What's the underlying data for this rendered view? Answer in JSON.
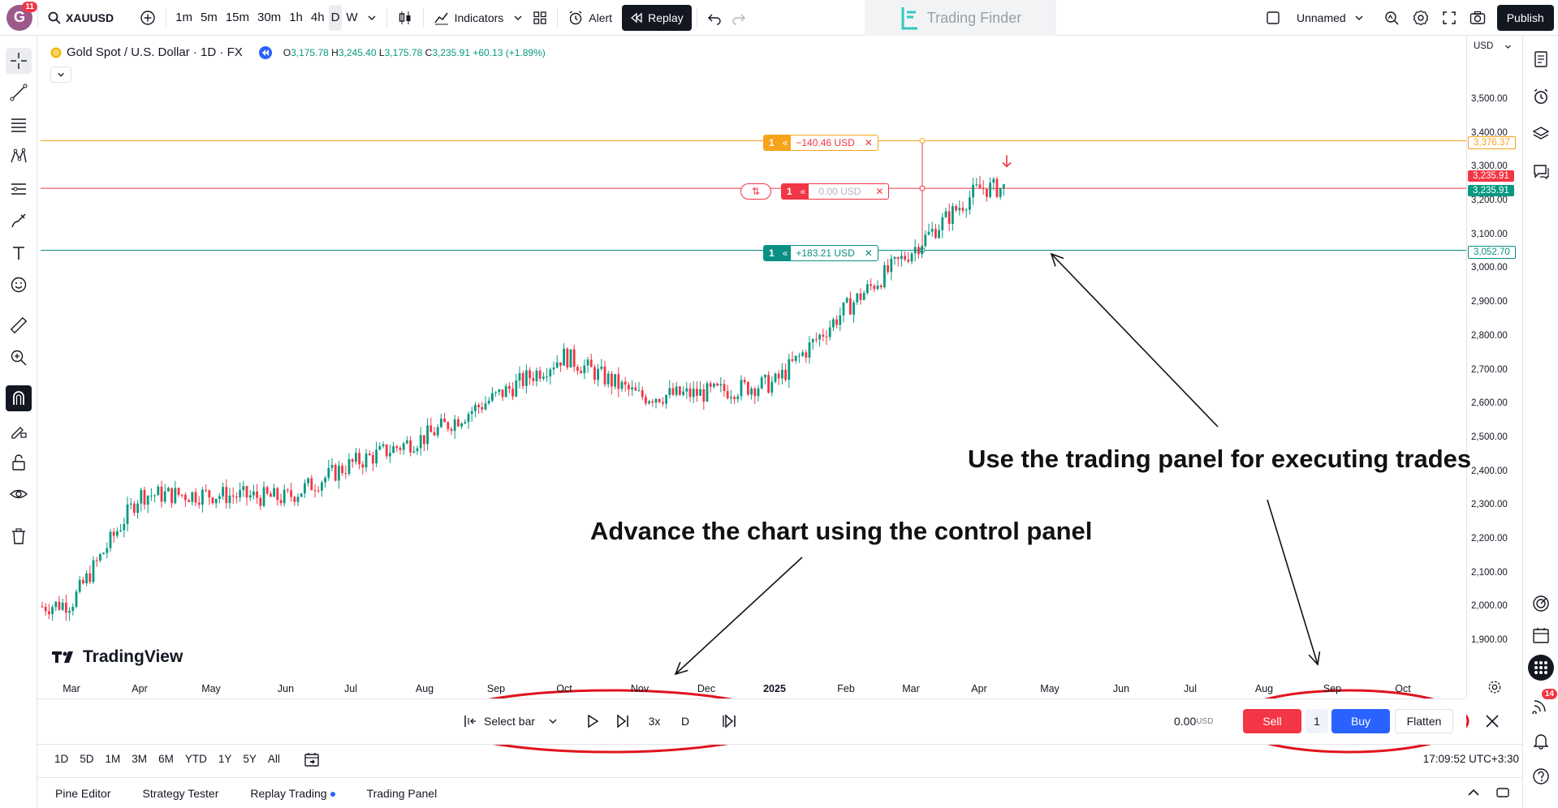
{
  "topbar": {
    "avatar_letter": "G",
    "notification_count": "11",
    "symbol": "XAUUSD",
    "intervals": [
      "1m",
      "5m",
      "15m",
      "30m",
      "1h",
      "4h",
      "D",
      "W"
    ],
    "indicators_label": "Indicators",
    "alert_label": "Alert",
    "replay_label": "Replay",
    "watermark": "Trading Finder",
    "layout_name": "Unnamed",
    "publish_label": "Publish"
  },
  "legend": {
    "title": "Gold Spot / U.S. Dollar · 1D · FX",
    "o_label": "O",
    "o": "3,175.78",
    "h_label": "H",
    "h": "3,245.40",
    "l_label": "L",
    "l": "3,175.78",
    "c_label": "C",
    "c": "3,235.91",
    "change": "+60.13 (+1.89%)"
  },
  "price_scale": {
    "currency": "USD",
    "labels": [
      "3,500.00",
      "3,400.00",
      "3,300.00",
      "3,200.00",
      "3,100.00",
      "3,000.00",
      "2,900.00",
      "2,800.00",
      "2,700.00",
      "2,600.00",
      "2,500.00",
      "2,400.00",
      "2,300.00",
      "2,200.00",
      "2,100.00",
      "2,000.00",
      "1,900.00"
    ],
    "tp_tag": "3,376.37",
    "last_tag": "3,235.91",
    "entry_tag": "3,235.91",
    "sl_tag": "3,052.70"
  },
  "orders": {
    "tp": {
      "qty": "1",
      "pnl": "−140.46 USD"
    },
    "entry": {
      "qty": "1",
      "pnl": "0.00 USD"
    },
    "sl": {
      "qty": "1",
      "pnl": "+183.21 USD"
    }
  },
  "time_axis": [
    "Mar",
    "Apr",
    "May",
    "Jun",
    "Jul",
    "Aug",
    "Sep",
    "Oct",
    "Nov",
    "Dec",
    "2025",
    "Feb",
    "Mar",
    "Apr",
    "May",
    "Jun",
    "Jul",
    "Aug",
    "Sep",
    "Oct"
  ],
  "brand": "TradingView",
  "annotations": {
    "trading_panel": "Use the trading panel for executing trades",
    "control_panel": "Advance the chart using the control panel"
  },
  "replay": {
    "select_bar": "Select bar",
    "speed": "3x",
    "interval": "D",
    "pnl": "0.00",
    "pnl_currency": "USD",
    "sell": "Sell",
    "qty": "1",
    "buy": "Buy",
    "flatten": "Flatten"
  },
  "ranges": [
    "1D",
    "5D",
    "1M",
    "3M",
    "6M",
    "YTD",
    "1Y",
    "5Y",
    "All"
  ],
  "clock": "17:09:52 UTC+3:30",
  "bottom_tabs": [
    "Pine Editor",
    "Strategy Tester",
    "Replay Trading",
    "Trading Panel"
  ],
  "right_badge": "14",
  "colors": {
    "up": "#089981",
    "down": "#f23645",
    "accent": "#2962ff",
    "tp": "#f7a21b",
    "sl": "#0a8f83"
  },
  "chart_data": {
    "type": "candlestick",
    "x_start": "2024-03",
    "x_end": "2025-04",
    "ylim": [
      1900,
      3500
    ],
    "key_points": [
      {
        "x": "Mar",
        "y": 2010
      },
      {
        "x": "Apr",
        "y": 2330
      },
      {
        "x": "May",
        "y": 2330
      },
      {
        "x": "Jun",
        "y": 2320
      },
      {
        "x": "Jul",
        "y": 2420
      },
      {
        "x": "Aug",
        "y": 2500
      },
      {
        "x": "Sep",
        "y": 2620
      },
      {
        "x": "Oct",
        "y": 2740
      },
      {
        "x": "Nov",
        "y": 2620
      },
      {
        "x": "Dec",
        "y": 2630
      },
      {
        "x": "2025",
        "y": 2660
      },
      {
        "x": "Feb",
        "y": 2880
      },
      {
        "x": "Mar",
        "y": 3050
      },
      {
        "x": "Apr",
        "y": 3236
      }
    ],
    "horizontal_lines": [
      3376.37,
      3235.91,
      3052.7
    ]
  }
}
